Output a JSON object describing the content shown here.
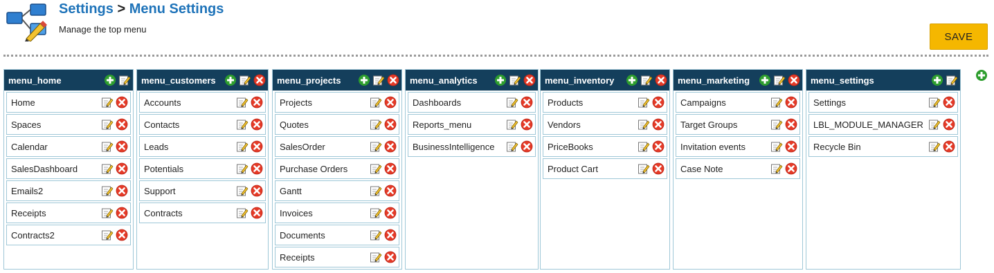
{
  "header": {
    "breadcrumb_root": "Settings",
    "breadcrumb_sep": ">",
    "breadcrumb_current": "Menu Settings",
    "subtitle": "Manage the top menu",
    "save_label": "SAVE"
  },
  "icons": {
    "add": "plus-icon",
    "edit": "edit-icon",
    "delete": "delete-icon",
    "page": "menu-settings-icon"
  },
  "colors": {
    "header_bg": "#143f5c",
    "title": "#1e73b9",
    "save_bg": "#f5b700",
    "add": "#2e9e2e",
    "delete": "#e53a27"
  },
  "columns": [
    {
      "name": "menu_home",
      "deletable": false,
      "items": [
        "Home",
        "Spaces",
        "Calendar",
        "SalesDashboard",
        "Emails2",
        "Receipts",
        "Contracts2"
      ]
    },
    {
      "name": "menu_customers",
      "deletable": true,
      "items": [
        "Accounts",
        "Contacts",
        "Leads",
        "Potentials",
        "Support",
        "Contracts"
      ]
    },
    {
      "name": "menu_projects",
      "deletable": true,
      "items": [
        "Projects",
        "Quotes",
        "SalesOrder",
        "Purchase Orders",
        "Gantt",
        "Invoices",
        "Documents",
        "Receipts"
      ]
    },
    {
      "name": "menu_analytics",
      "deletable": true,
      "items": [
        "Dashboards",
        "Reports_menu",
        "BusinessIntelligence"
      ]
    },
    {
      "name": "menu_inventory",
      "deletable": true,
      "items": [
        "Products",
        "Vendors",
        "PriceBooks",
        "Product Cart"
      ]
    },
    {
      "name": "menu_marketing",
      "deletable": true,
      "items": [
        "Campaigns",
        "Target Groups",
        "Invitation events",
        "Case Note"
      ]
    },
    {
      "name": "menu_settings",
      "deletable": false,
      "items": [
        "Settings",
        "LBL_MODULE_MANAGER",
        "Recycle Bin"
      ]
    }
  ]
}
